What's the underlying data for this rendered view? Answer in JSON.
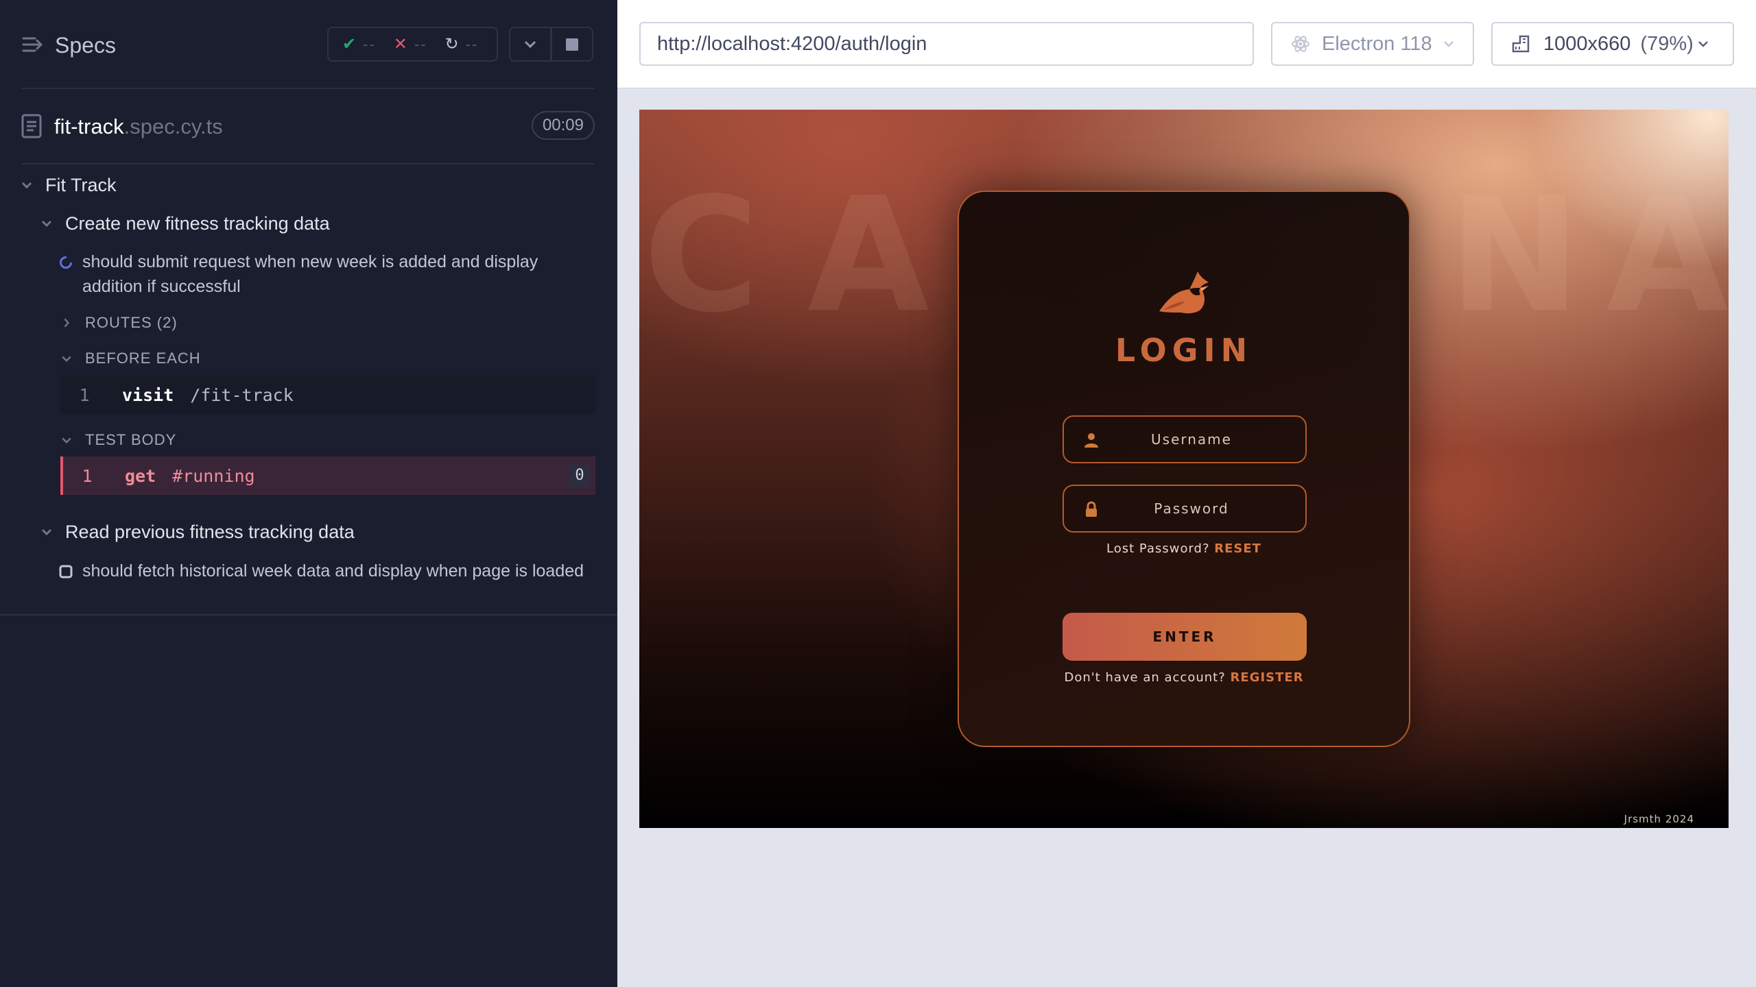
{
  "reporter": {
    "specs_label": "Specs",
    "stats": {
      "passed": "--",
      "failed": "--",
      "pending": "--"
    },
    "file": {
      "base": "fit-track",
      "ext": ".spec.cy.ts",
      "duration": "00:09"
    },
    "suite_title": "Fit Track",
    "groups": [
      {
        "title": "Create new fitness tracking data",
        "test_title": "should submit request when new week is added and display addition if successful",
        "routes_label": "ROUTES (2)",
        "before_each_label": "BEFORE EACH",
        "before_cmd": {
          "num": "1",
          "name": "visit",
          "message": "/fit-track"
        },
        "test_body_label": "TEST BODY",
        "body_cmd": {
          "num": "1",
          "name": "get",
          "message": "#running",
          "count": "0"
        }
      },
      {
        "title": "Read previous fitness tracking data",
        "test_title": "should fetch historical week data and display when page is loaded"
      }
    ]
  },
  "aut": {
    "url": "http://localhost:4200/auth/login",
    "browser": "Electron 118",
    "viewport": "1000x660",
    "scale": "(79%)"
  },
  "app": {
    "bg_letters": [
      "C",
      "A",
      "N",
      "A"
    ],
    "title": "LOGIN",
    "username_placeholder": "Username",
    "password_placeholder": "Password",
    "lost_password_text": "Lost Password?",
    "reset_link": "RESET",
    "enter_label": "ENTER",
    "no_account_text": "Don't have an account?",
    "register_link": "REGISTER",
    "credit": "Jrsmth 2024"
  },
  "colors": {
    "accent": "#c96a3e",
    "passed": "#1fa971",
    "failed": "#e45770",
    "reporter_bg": "#1b1e2e"
  }
}
